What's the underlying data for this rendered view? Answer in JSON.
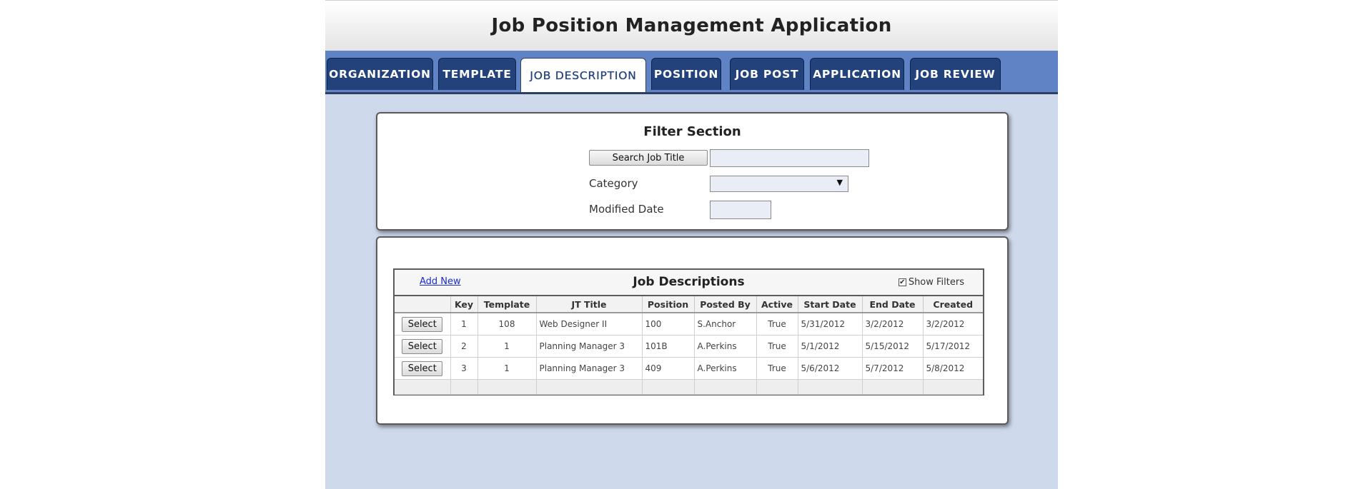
{
  "app": {
    "title": "Job Position Management Application"
  },
  "tabs": [
    {
      "label": "ORGANIZATION",
      "active": false
    },
    {
      "label": "TEMPLATE",
      "active": false
    },
    {
      "label": "JOB DESCRIPTION",
      "active": true
    },
    {
      "label": "POSITION",
      "active": false
    },
    {
      "label": "JOB POST",
      "active": false
    },
    {
      "label": "APPLICATION",
      "active": false
    },
    {
      "label": "JOB REVIEW",
      "active": false
    }
  ],
  "filter": {
    "title": "Filter Section",
    "search_button": "Search Job Title",
    "search_value": "",
    "category_label": "Category",
    "category_value": "",
    "modified_label": "Modified Date",
    "modified_value": ""
  },
  "grid": {
    "title": "Job Descriptions",
    "add_new": "Add New",
    "show_filters": "Show Filters",
    "show_filters_checked": true,
    "select_label": "Select",
    "columns": [
      "",
      "Key",
      "Template",
      "JT Title",
      "Position",
      "Posted By",
      "Active",
      "Start Date",
      "End Date",
      "Created"
    ],
    "rows": [
      {
        "key": "1",
        "template": "108",
        "title": "Web Designer II",
        "position": "100",
        "posted_by": "S.Anchor",
        "active": "True",
        "start": "5/31/2012",
        "end": "3/2/2012",
        "created": "3/2/2012"
      },
      {
        "key": "2",
        "template": "1",
        "title": "Planning Manager 3",
        "position": "101B",
        "posted_by": "A.Perkins",
        "active": "True",
        "start": "5/1/2012",
        "end": "5/15/2012",
        "created": "5/17/2012"
      },
      {
        "key": "3",
        "template": "1",
        "title": "Planning Manager 3",
        "position": "409",
        "posted_by": "A.Perkins",
        "active": "True",
        "start": "5/6/2012",
        "end": "5/7/2012",
        "created": "5/8/2012"
      }
    ]
  },
  "colors": {
    "tab_bg": "#23427c",
    "tabbar_bg": "#5f83c4",
    "content_bg": "#cfd9ec",
    "link": "#1a2bd6"
  }
}
